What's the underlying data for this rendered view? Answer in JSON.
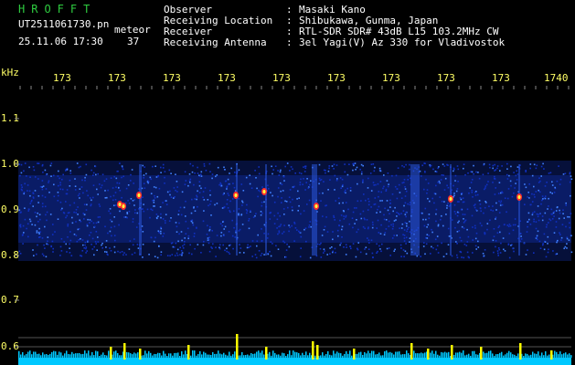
{
  "header": {
    "program": "HROFFT",
    "filename": "UT2511061730.pn",
    "tag": "meteor",
    "datetime": "25.11.06 17:30",
    "count": "37",
    "info": [
      {
        "label": "Observer",
        "sep": ":",
        "value": "Masaki Kano"
      },
      {
        "label": "Receiving Location",
        "sep": ":",
        "value": "Shibukawa, Gunma, Japan"
      },
      {
        "label": "Receiver",
        "sep": ":",
        "value": "RTL-SDR SDR# 43dB L15 103.2MHz CW"
      },
      {
        "label": "Receiving Antenna",
        "sep": ":",
        "value": "3el Yagi(V) Az 330 for Vladivostok"
      }
    ]
  },
  "axis": {
    "unit": "kHz",
    "y_labels": [
      "1.1",
      "1.0",
      "0.9",
      "0.8",
      "0.7",
      "0.6"
    ],
    "time_labels": [
      "173",
      "173",
      "173",
      "173",
      "173",
      "173",
      "173",
      "173",
      "173",
      "1740"
    ]
  },
  "colors": {
    "background": "#000000",
    "label": "#ffff66",
    "title": "#2ecc40",
    "noise_low": "#1030c0",
    "noise_high": "#4080ff",
    "echo": "#ff3030",
    "waveform_baseline": "#00c8ff",
    "waveform_peak": "#ffff00"
  }
}
